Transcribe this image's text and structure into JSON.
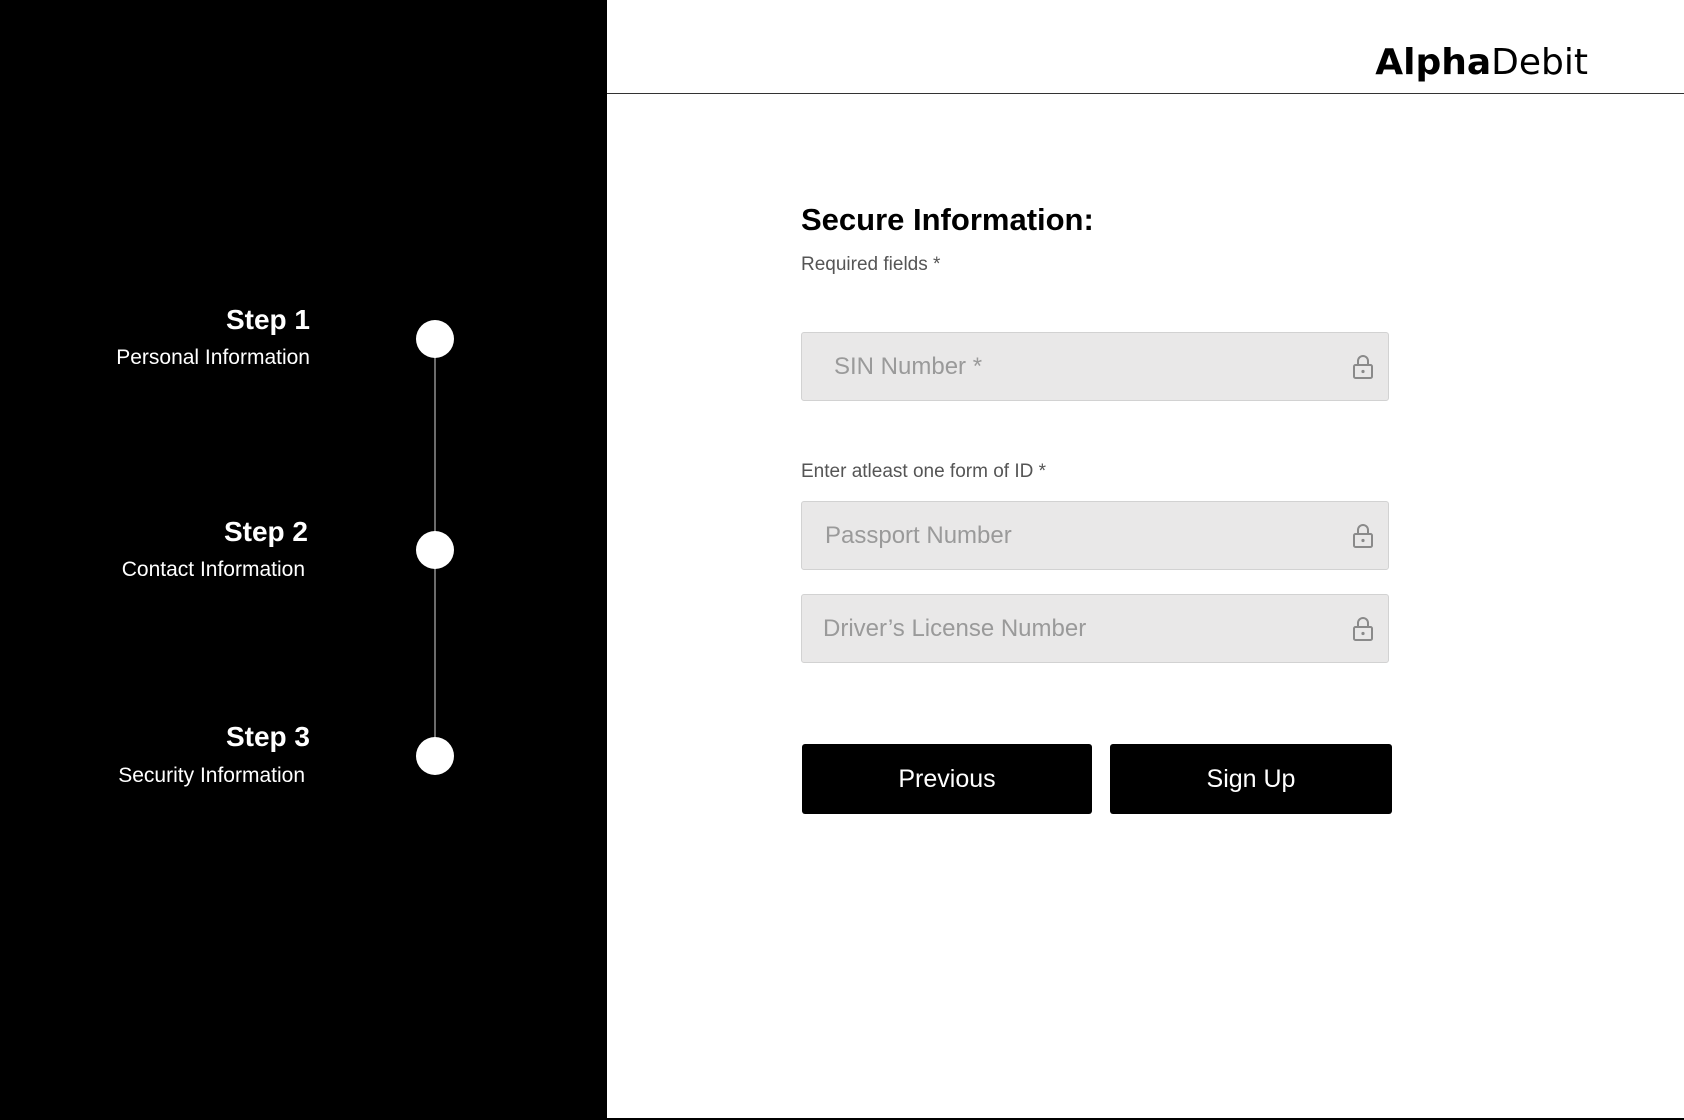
{
  "brand": {
    "name_bold": "Alpha",
    "name_regular": "Debit"
  },
  "steps": [
    {
      "title": "Step 1",
      "subtitle": "Personal Information"
    },
    {
      "title": "Step 2",
      "subtitle": "Contact Information"
    },
    {
      "title": "Step 3",
      "subtitle": "Security Information"
    }
  ],
  "form": {
    "title": "Secure Information:",
    "required_hint": "Required fields *",
    "sin": {
      "placeholder": "SIN Number *",
      "value": ""
    },
    "id_hint": "Enter atleast one form of ID *",
    "passport": {
      "placeholder": "Passport Number",
      "value": ""
    },
    "license": {
      "placeholder": "Driver’s License Number",
      "value": ""
    }
  },
  "buttons": {
    "previous": "Previous",
    "signup": "Sign Up"
  },
  "icons": {
    "field_icon": "lock-icon"
  },
  "colors": {
    "sidebar_bg": "#000000",
    "field_bg": "#e9e8e8",
    "button_bg": "#000000"
  }
}
